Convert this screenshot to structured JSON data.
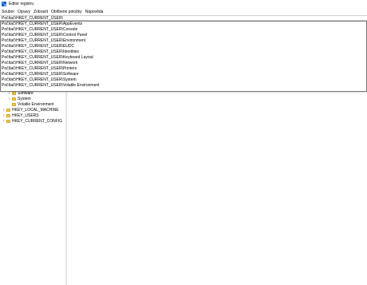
{
  "window": {
    "title": "Editor registru"
  },
  "menu": [
    {
      "label": "Soubor"
    },
    {
      "label": "Úpravy"
    },
    {
      "label": "Zobrazit"
    },
    {
      "label": "Oblíbené položky"
    },
    {
      "label": "Nápověda"
    }
  ],
  "address": {
    "value": "Počítač\\HKEY_CURRENT_USER\\"
  },
  "suggestions": [
    {
      "label": "Počítač\\HKEY_CURRENT_USER\\AppEvents"
    },
    {
      "label": "Počítač\\HKEY_CURRENT_USER\\Console"
    },
    {
      "label": "Počítač\\HKEY_CURRENT_USER\\Control Panel"
    },
    {
      "label": "Počítač\\HKEY_CURRENT_USER\\Environment"
    },
    {
      "label": "Počítač\\HKEY_CURRENT_USER\\EUDC"
    },
    {
      "label": "Počítač\\HKEY_CURRENT_USER\\Identities"
    },
    {
      "label": "Počítač\\HKEY_CURRENT_USER\\Keyboard Layout"
    },
    {
      "label": "Počítač\\HKEY_CURRENT_USER\\Network"
    },
    {
      "label": "Počítač\\HKEY_CURRENT_USER\\Printers"
    },
    {
      "label": "Počítač\\HKEY_CURRENT_USER\\Software"
    },
    {
      "label": "Počítač\\HKEY_CURRENT_USER\\System"
    },
    {
      "label": "Počítač\\HKEY_CURRENT_USER\\Volatile Environment"
    }
  ],
  "tree": {
    "items": [
      {
        "label": "Software",
        "expander": "›",
        "icon": "folder-icon"
      },
      {
        "label": "System",
        "expander": "›",
        "icon": "folder-icon"
      },
      {
        "label": "Volatile Environment",
        "expander": "",
        "icon": "folder-icon"
      },
      {
        "label": "HKEY_LOCAL_MACHINE",
        "expander": "›",
        "icon": "folder-icon"
      },
      {
        "label": "HKEY_USERS",
        "expander": "›",
        "icon": "folder-icon"
      },
      {
        "label": "HKEY_CURRENT_CONFIG",
        "expander": "›",
        "icon": "folder-icon"
      }
    ]
  },
  "colors": {
    "folder": "#f2c94c",
    "app_icon": "#3b7fd6"
  }
}
